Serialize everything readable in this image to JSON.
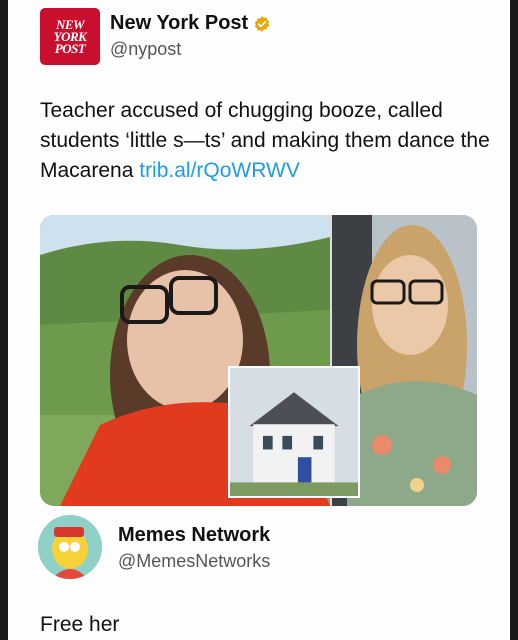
{
  "post": {
    "logo_lines": [
      "NEW",
      "YORK",
      "POST"
    ],
    "author_name": "New York Post",
    "author_handle": "@nypost",
    "verified_badge": "gold-check-icon",
    "text": "Teacher accused of chugging booze, called students ‘little s—ts’ and making them dance the Macarena",
    "link_text": "trib.al/rQoWRWV"
  },
  "reply": {
    "author_name": "Memes Network",
    "author_handle": "@MemesNetworks",
    "text": "Free her"
  },
  "colors": {
    "brand_red": "#c8102e",
    "link_blue": "#1d9bf0",
    "gold_badge": "#e8a80c"
  }
}
